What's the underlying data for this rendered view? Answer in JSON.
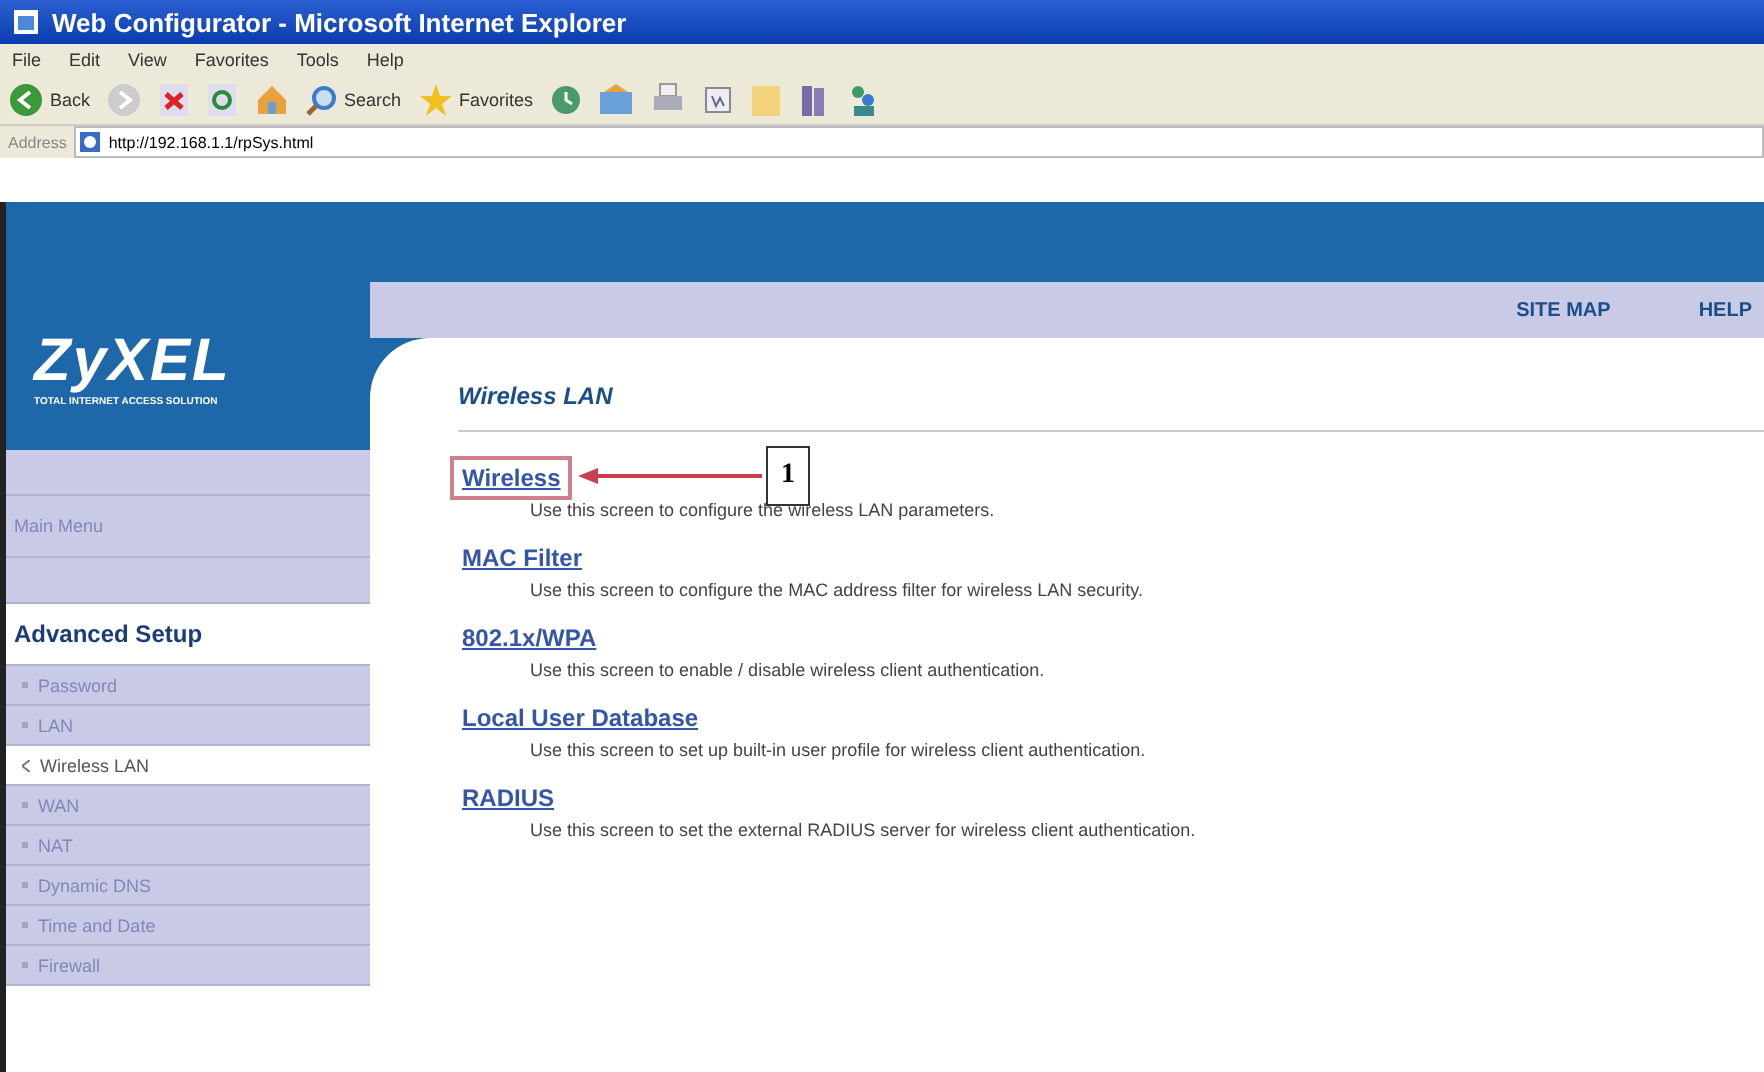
{
  "window": {
    "title": "Web Configurator - Microsoft Internet Explorer"
  },
  "menu": [
    "File",
    "Edit",
    "View",
    "Favorites",
    "Tools",
    "Help"
  ],
  "toolbar": [
    {
      "kind": "back",
      "label": "Back"
    },
    {
      "kind": "forward"
    },
    {
      "kind": "stop"
    },
    {
      "kind": "refresh"
    },
    {
      "kind": "home"
    },
    {
      "kind": "search",
      "label": "Search"
    },
    {
      "kind": "favorites",
      "label": "Favorites"
    },
    {
      "kind": "history"
    },
    {
      "kind": "mail"
    },
    {
      "kind": "print"
    },
    {
      "kind": "edit"
    },
    {
      "kind": "folder"
    },
    {
      "kind": "research"
    },
    {
      "kind": "messenger"
    }
  ],
  "address": {
    "label": "Address",
    "value": "http://192.168.1.1/rpSys.html"
  },
  "logo": {
    "name": "ZyXEL",
    "tagline": "TOTAL INTERNET ACCESS SOLUTION"
  },
  "top_links": [
    "SITE MAP",
    "HELP"
  ],
  "sidebar": [
    {
      "kind": "blank"
    },
    {
      "kind": "link",
      "label": "Main Menu",
      "selected": false
    },
    {
      "kind": "blank"
    },
    {
      "kind": "header",
      "label": "Advanced Setup"
    },
    {
      "kind": "item",
      "label": "Password",
      "selected": false
    },
    {
      "kind": "item",
      "label": "LAN",
      "selected": false
    },
    {
      "kind": "item",
      "label": "Wireless LAN",
      "selected": true
    },
    {
      "kind": "item",
      "label": "WAN",
      "selected": false
    },
    {
      "kind": "item",
      "label": "NAT",
      "selected": false
    },
    {
      "kind": "item",
      "label": "Dynamic DNS",
      "selected": false
    },
    {
      "kind": "item",
      "label": "Time and Date",
      "selected": false
    },
    {
      "kind": "item",
      "label": "Firewall",
      "selected": false
    }
  ],
  "content": {
    "heading": "Wireless LAN",
    "entries": [
      {
        "title": "Wireless",
        "description": "Use this screen to configure the wireless LAN parameters.",
        "highlighted": true
      },
      {
        "title": "MAC Filter",
        "description": "Use this screen to configure the MAC address filter for wireless LAN security.",
        "highlighted": false
      },
      {
        "title": "802.1x/WPA",
        "description": "Use this screen to enable / disable wireless client authentication.",
        "highlighted": false
      },
      {
        "title": "Local User Database",
        "description": "Use this screen to set up built-in user profile for wireless client authentication.",
        "highlighted": false
      },
      {
        "title": "RADIUS",
        "description": "Use this screen to set the external RADIUS server for wireless client authentication.",
        "highlighted": false
      }
    ]
  },
  "callout": {
    "label": "1"
  }
}
